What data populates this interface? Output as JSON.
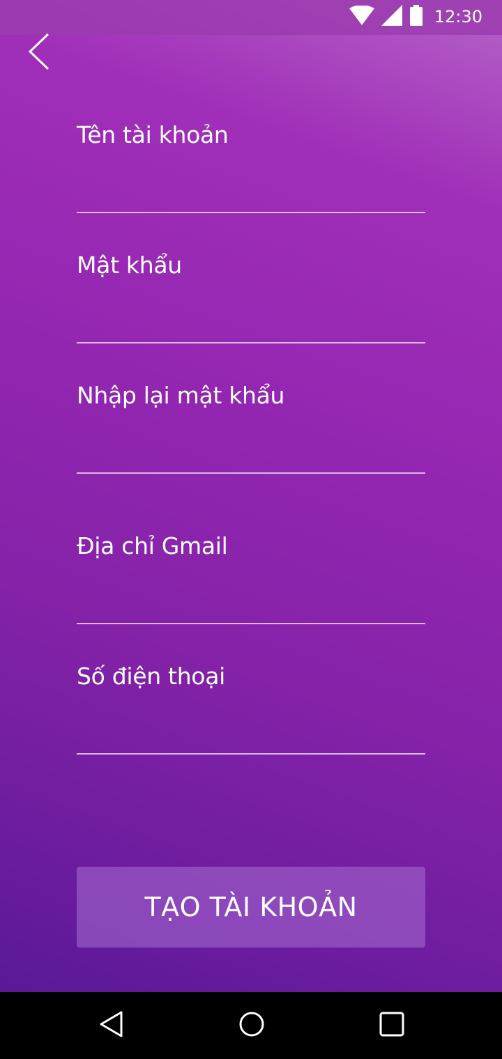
{
  "status_bar": {
    "time": "12:30",
    "icons": [
      "wifi-icon",
      "signal-icon",
      "battery-icon"
    ]
  },
  "header": {
    "back_icon": "chevron-left-icon"
  },
  "form": {
    "fields": [
      {
        "label": "Tên tài khoản",
        "value": ""
      },
      {
        "label": "Mật khẩu",
        "value": ""
      },
      {
        "label": "Nhập lại mật khẩu",
        "value": ""
      },
      {
        "label": "Địa chỉ Gmail",
        "value": ""
      },
      {
        "label": "Số điện thoại",
        "value": ""
      }
    ],
    "submit_label": "TẠO TÀI KHOẢN"
  },
  "nav_bar": {
    "icons": [
      "back-triangle-icon",
      "home-circle-icon",
      "recents-square-icon"
    ]
  },
  "colors": {
    "gradient_top": "#b563c8",
    "gradient_mid": "#9527b2",
    "gradient_bottom": "#5a1996",
    "text": "#ffffff",
    "underline": "#ebd2f0"
  }
}
